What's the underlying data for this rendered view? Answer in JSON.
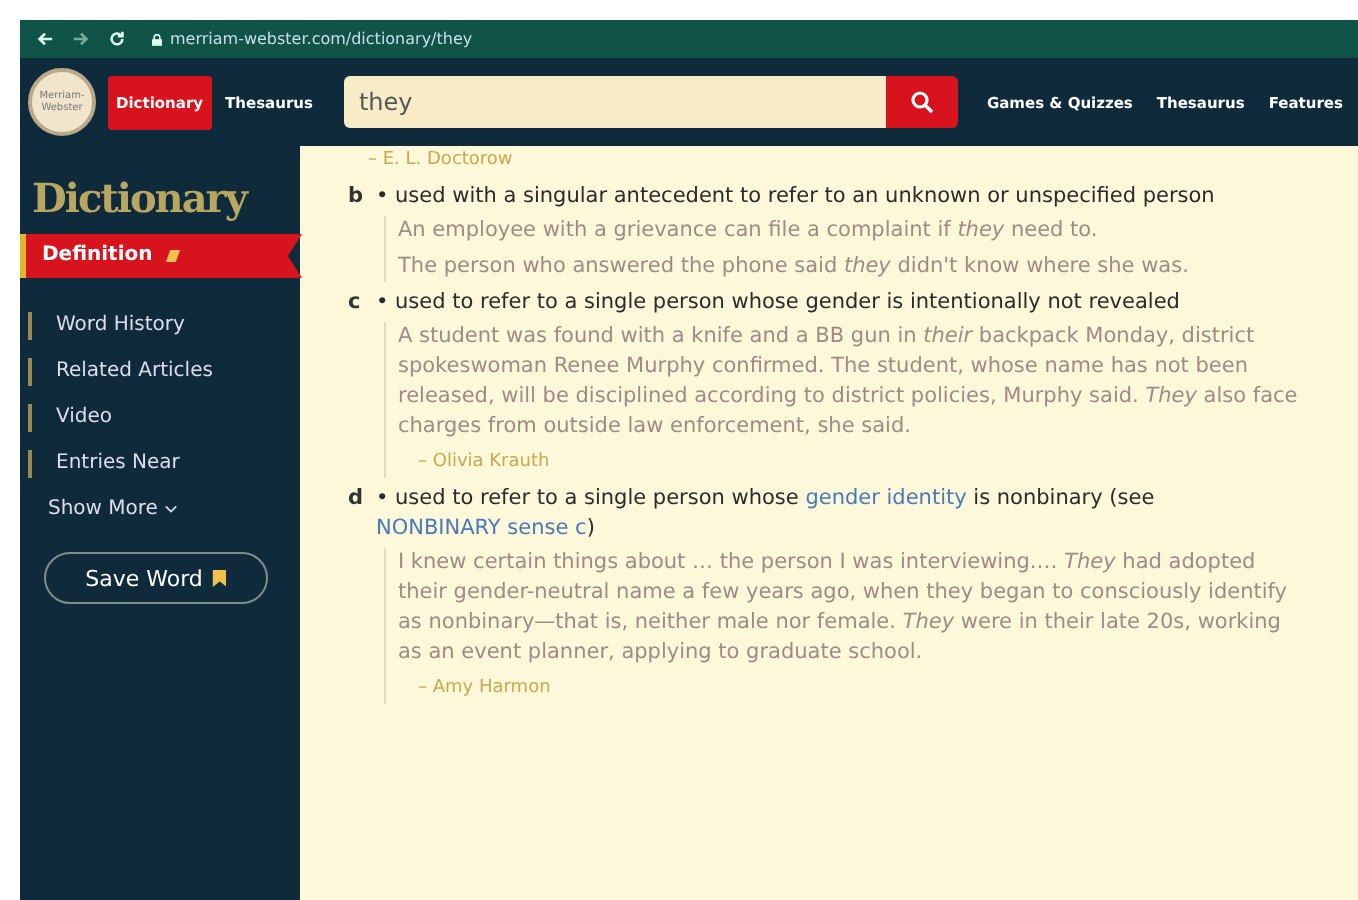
{
  "browser": {
    "url": "merriam-webster.com/dictionary/they"
  },
  "header": {
    "logo": "Merriam-Webster",
    "tabs": [
      {
        "label": "Dictionary",
        "selected": true
      },
      {
        "label": "Thesaurus",
        "selected": false
      }
    ],
    "search": {
      "value": "they"
    },
    "nav": [
      "Games & Quizzes",
      "Thesaurus",
      "Features"
    ]
  },
  "sidebar": {
    "title": "Dictionary",
    "items": [
      {
        "label": "Definition",
        "selected": true
      },
      {
        "label": "Word History",
        "selected": false
      },
      {
        "label": "Related Articles",
        "selected": false
      },
      {
        "label": "Video",
        "selected": false
      },
      {
        "label": "Entries Near",
        "selected": false
      }
    ],
    "show_more": "Show More",
    "save_button": "Save Word"
  },
  "content": {
    "top_attribution": "– E. L. Doctorow",
    "senses": [
      {
        "letter": "b",
        "definition": [
          {
            "kind": "text",
            "text": "• used with a singular antecedent to refer to an unknown or unspecified person"
          }
        ],
        "examples": [
          "An employee with a grievance can file a complaint if *they* need to.",
          "The person who answered the phone said *they* didn't know where she was."
        ]
      },
      {
        "letter": "c",
        "definition": [
          {
            "kind": "text",
            "text": "• used to refer to a single person whose gender is intentionally not revealed"
          }
        ],
        "examples": [
          "A student was found with a knife and a BB gun in *their* backpack Monday, district spokeswoman Renee Murphy confirmed. The student, whose name has not been released, will be disciplined according to district policies, Murphy said. *They* also face charges from outside law enforcement, she said."
        ],
        "attribution": "– Olivia Krauth"
      },
      {
        "letter": "d",
        "definition": [
          {
            "kind": "text",
            "text": "• used to refer to a single person whose "
          },
          {
            "kind": "link",
            "text": "gender identity"
          },
          {
            "kind": "text",
            "text": " is nonbinary (see "
          },
          {
            "kind": "link",
            "text": "NONBINARY sense c"
          },
          {
            "kind": "text",
            "text": ")"
          }
        ],
        "examples": [
          "I knew certain things about … the person I was interviewing.… *They* had adopted their gender-neutral name a few years ago, when they began to consciously identify as nonbinary—that is, neither male nor female. *They* were in their late 20s, working as an event planner, applying to graduate school."
        ],
        "attribution": "– Amy Harmon"
      }
    ]
  }
}
